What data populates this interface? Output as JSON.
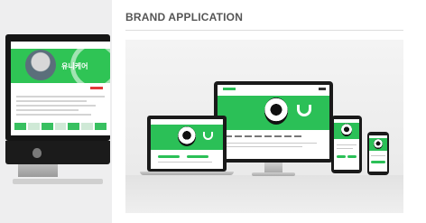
{
  "section": {
    "title": "BRAND APPLICATION"
  },
  "site": {
    "brand_text": "유니케어"
  },
  "colors": {
    "brand_green": "#2bc057",
    "accent_red": "#e03a3a",
    "title_gray": "#555555"
  }
}
